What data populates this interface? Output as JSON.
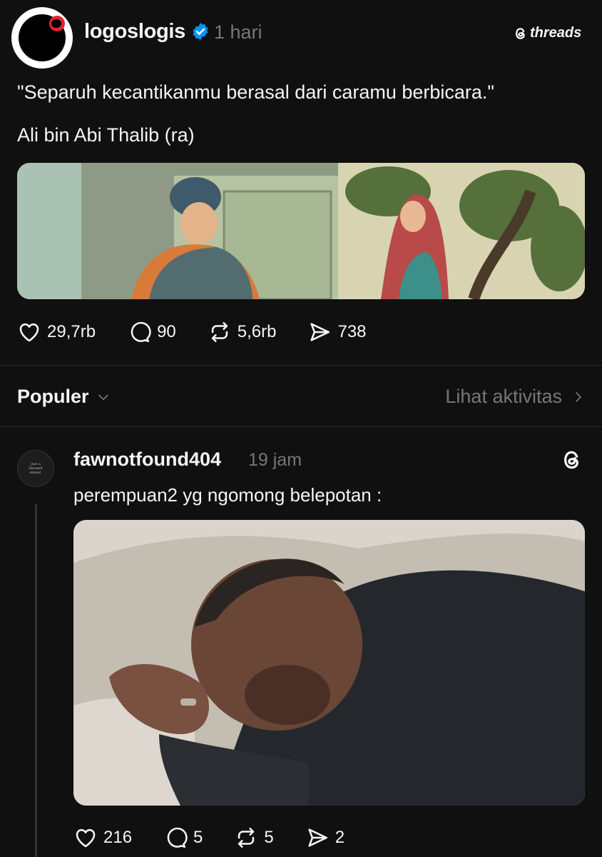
{
  "post": {
    "username": "logoslogis",
    "time": "1 hari",
    "brand": "threads",
    "quote": "\"Separuh kecantikanmu berasal dari caramu berbicara.\"",
    "author": "Ali bin Abi Thalib (ra)",
    "stats": {
      "likes": "29,7rb",
      "replies": "90",
      "reposts": "5,6rb",
      "shares": "738"
    }
  },
  "filter": {
    "label": "Populer",
    "activity_link": "Lihat aktivitas"
  },
  "reply": {
    "avatar_text": "just a blessed sinner.",
    "username": "fawnotfound404",
    "time": "19 jam",
    "text": "perempuan2 yg ngomong belepotan :",
    "stats": {
      "likes": "216",
      "replies": "5",
      "reposts": "5",
      "shares": "2"
    }
  },
  "colors": {
    "background": "#101010",
    "text": "#f3f5f7",
    "muted": "#777777",
    "verified": "#0095f6"
  }
}
